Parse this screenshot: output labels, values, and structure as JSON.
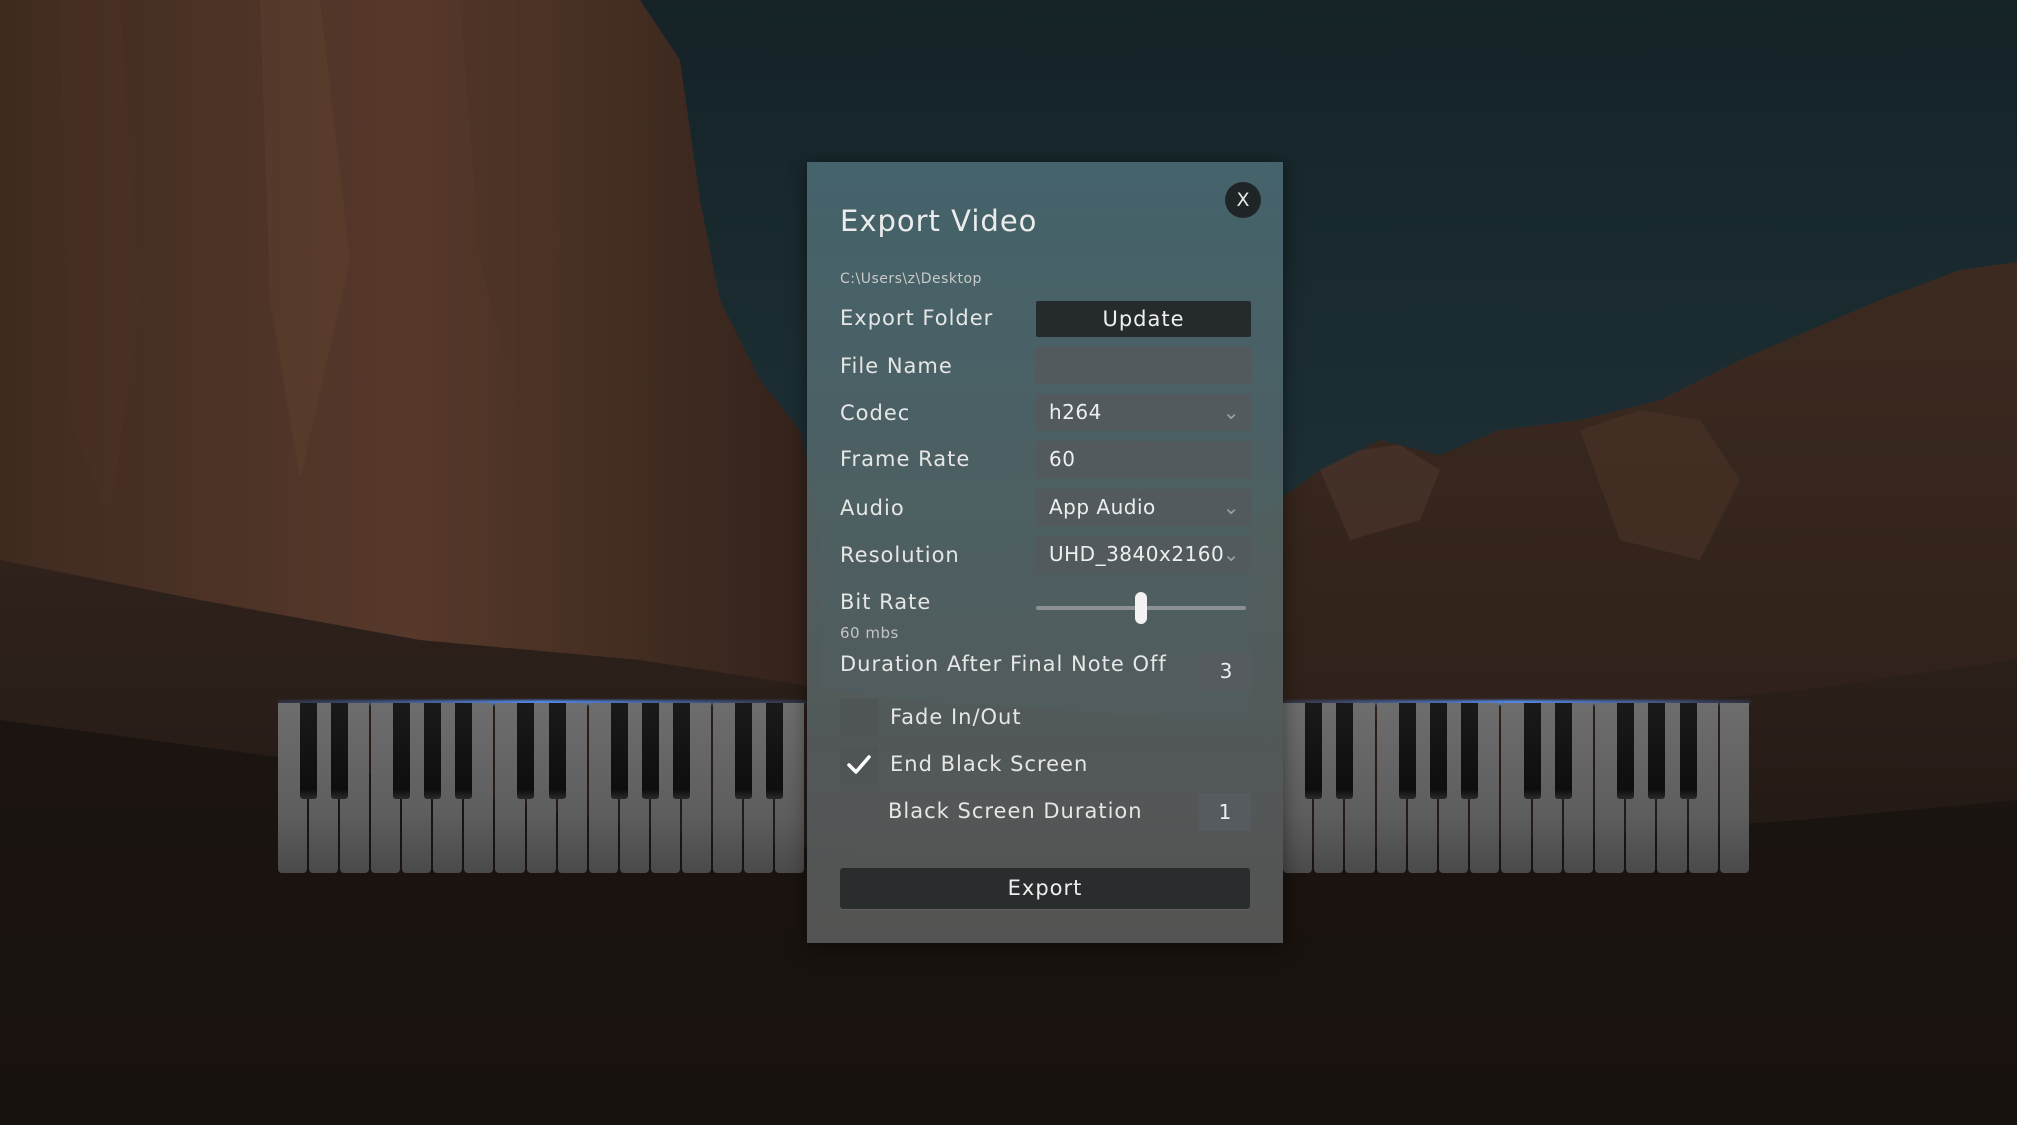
{
  "dialog": {
    "title": "Export Video",
    "close_label": "X",
    "path": "C:\\Users\\z\\Desktop",
    "export_folder_label": "Export Folder",
    "update_label": "Update",
    "file_name_label": "File Name",
    "file_name_value": "",
    "codec_label": "Codec",
    "codec_value": "h264",
    "frame_rate_label": "Frame Rate",
    "frame_rate_value": "60",
    "audio_label": "Audio",
    "audio_value": "App Audio",
    "resolution_label": "Resolution",
    "resolution_value": "UHD_3840x2160",
    "bit_rate_label": "Bit Rate",
    "bit_rate_value": "60 mbs",
    "bit_rate_fraction": 0.5,
    "duration_label": "Duration After Final Note Off",
    "duration_value": "3",
    "fade_label": "Fade In/Out",
    "fade_checked": false,
    "end_black_label": "End Black Screen",
    "end_black_checked": true,
    "black_duration_label": "Black Screen Duration",
    "black_duration_value": "1",
    "export_label": "Export"
  },
  "icons": {
    "dropdown": "chevron-down-icon",
    "check": "checkmark-icon",
    "close": "close-icon"
  },
  "colors": {
    "dialog_top": "#486870",
    "dialog_bottom": "#5c5c5c",
    "button_dark": "#252b2d",
    "field": "#525a5d",
    "piano_glow": "#5a96ff"
  }
}
